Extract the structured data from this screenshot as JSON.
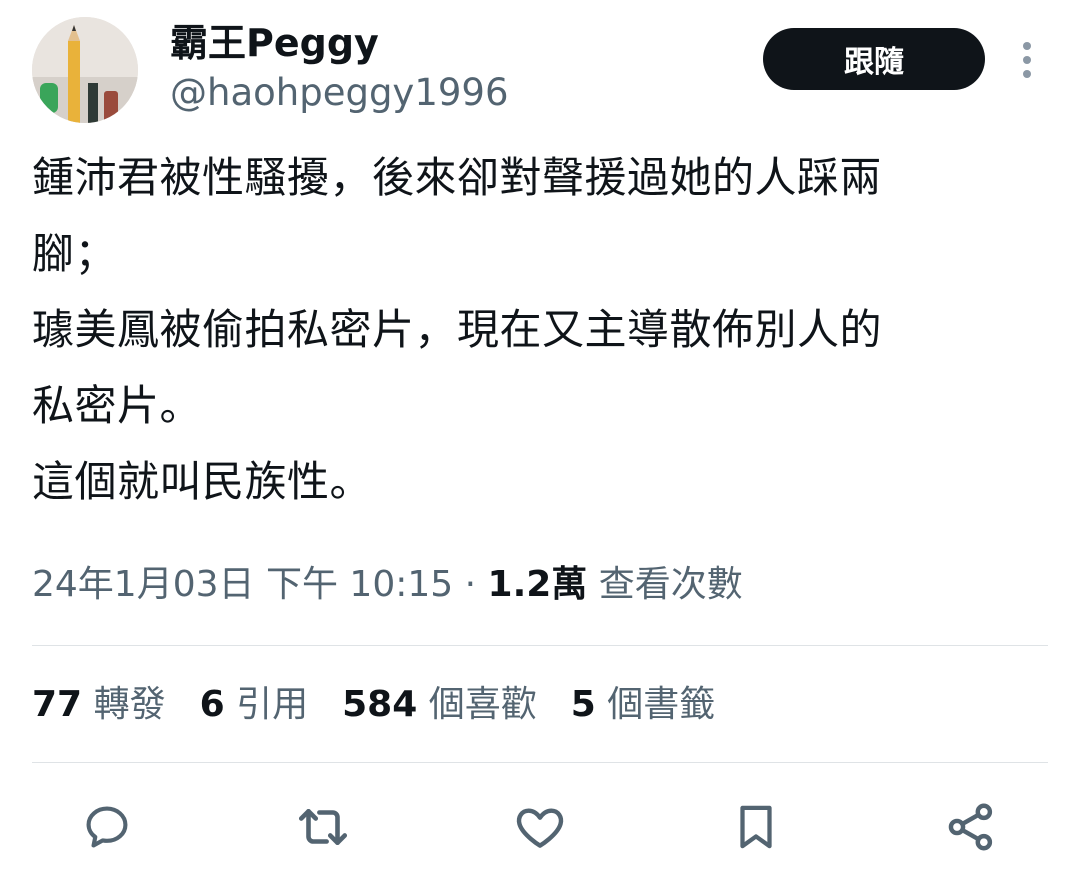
{
  "user": {
    "display_name": "霸王Peggy",
    "handle": "@haohpeggy1996",
    "avatar_icon": "pencil-photo-avatar"
  },
  "follow_button": {
    "label": "跟隨"
  },
  "more_icon": "more-vertical-icon",
  "tweet": {
    "lines": [
      "鍾沛君被性騷擾，後來卻對聲援過她的人踩兩",
      "腳；",
      "璩美鳳被偷拍私密片，現在又主導散佈別人的",
      "私密片。",
      "這個就叫民族性。"
    ]
  },
  "meta": {
    "timestamp": "24年1月03日 下午 10:15",
    "separator": "·",
    "views_count": "1.2萬",
    "views_label": "查看次數"
  },
  "stats": [
    {
      "count": "77",
      "label": "轉發"
    },
    {
      "count": "6",
      "label": "引用"
    },
    {
      "count": "584",
      "label": "個喜歡"
    },
    {
      "count": "5",
      "label": "個書籤"
    }
  ],
  "actions": [
    "reply-icon",
    "retweet-icon",
    "like-icon",
    "bookmark-icon",
    "share-icon"
  ],
  "colors": {
    "text": "#0f1419",
    "secondary": "#536471",
    "divider": "#dfe3e6",
    "button_bg": "#0f1419"
  }
}
